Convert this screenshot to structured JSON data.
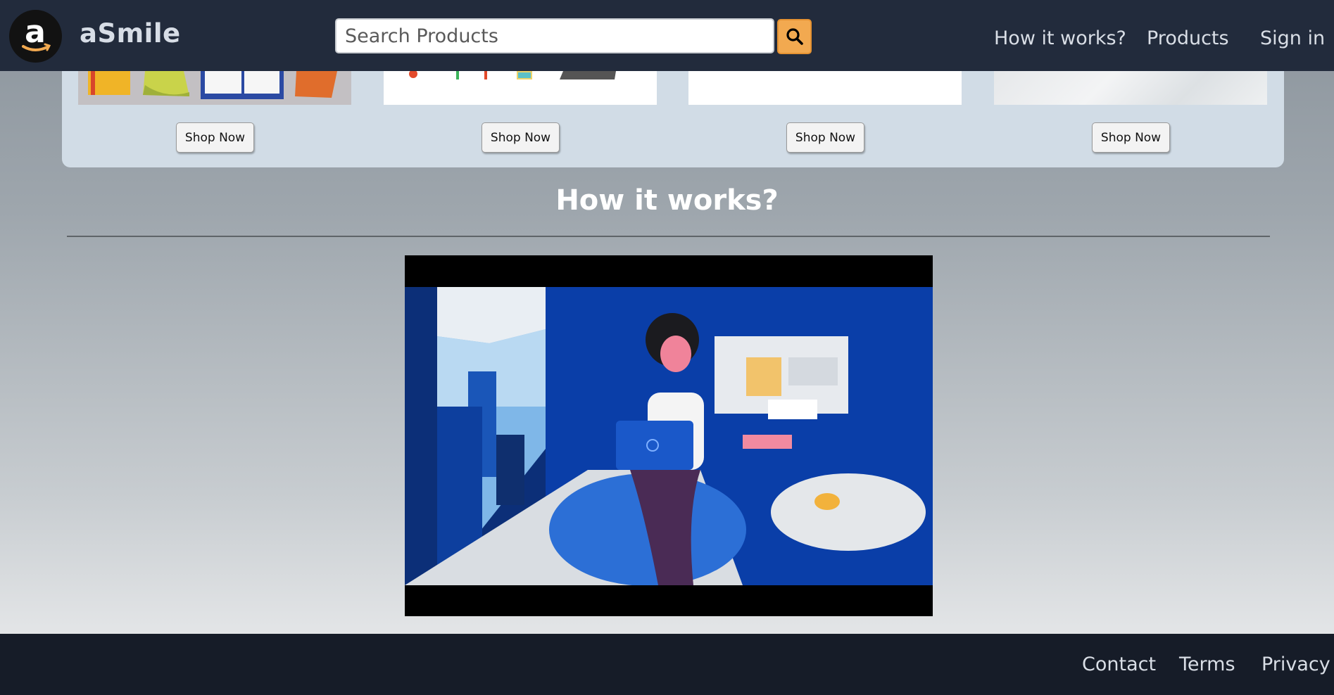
{
  "header": {
    "brand": "aSmile",
    "logo_icon": "amazon-logo-icon",
    "search_placeholder": "Search Products",
    "search_icon": "search-icon",
    "nav": [
      "How it works?",
      "Products",
      "Sign in"
    ]
  },
  "products": {
    "shop_labels": [
      "Shop Now",
      "Shop Now",
      "Shop Now",
      "Shop Now"
    ]
  },
  "how_it_works": {
    "title": "How it works?"
  },
  "footer": {
    "links": [
      "Contact",
      "Terms",
      "Privacy"
    ]
  },
  "colors": {
    "header_bg": "#222b3c",
    "footer_bg": "#161c28",
    "accent": "#f2a950"
  }
}
